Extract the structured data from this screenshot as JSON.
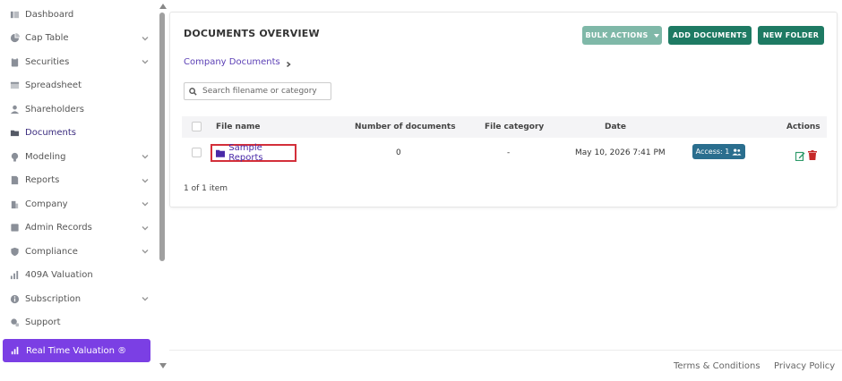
{
  "sidebar": {
    "items": [
      {
        "label": "Dashboard",
        "icon": "dashboard-icon",
        "chevron": false,
        "active": false
      },
      {
        "label": "Cap Table",
        "icon": "pie-chart-icon",
        "chevron": true,
        "active": false
      },
      {
        "label": "Securities",
        "icon": "clipboard-icon",
        "chevron": true,
        "active": false
      },
      {
        "label": "Spreadsheet",
        "icon": "spreadsheet-icon",
        "chevron": false,
        "active": false
      },
      {
        "label": "Shareholders",
        "icon": "user-icon",
        "chevron": false,
        "active": false
      },
      {
        "label": "Documents",
        "icon": "folder-icon",
        "chevron": false,
        "active": true
      },
      {
        "label": "Modeling",
        "icon": "lightbulb-icon",
        "chevron": true,
        "active": false
      },
      {
        "label": "Reports",
        "icon": "report-icon",
        "chevron": true,
        "active": false
      },
      {
        "label": "Company",
        "icon": "building-icon",
        "chevron": true,
        "active": false
      },
      {
        "label": "Admin Records",
        "icon": "records-icon",
        "chevron": true,
        "active": false
      },
      {
        "label": "Compliance",
        "icon": "shield-icon",
        "chevron": true,
        "active": false
      },
      {
        "label": "409A Valuation",
        "icon": "bar-chart-icon",
        "chevron": false,
        "active": false
      },
      {
        "label": "Subscription",
        "icon": "info-icon",
        "chevron": true,
        "active": false
      },
      {
        "label": "Support",
        "icon": "support-icon",
        "chevron": false,
        "active": false
      }
    ],
    "rtv_label": "Real Time Valuation ®"
  },
  "documents": {
    "title": "DOCUMENTS OVERVIEW",
    "bulk_actions": "BULK ACTIONS",
    "add_documents": "ADD DOCUMENTS",
    "new_folder": "NEW FOLDER",
    "breadcrumb": "Company Documents",
    "search_placeholder": "Search filename or category",
    "columns": {
      "file_name": "File name",
      "num_docs": "Number of documents",
      "category": "File category",
      "date": "Date",
      "actions": "Actions"
    },
    "rows": [
      {
        "name": "Sample Reports",
        "num_docs": "0",
        "category": "-",
        "date": "May 10, 2026 7:41 PM",
        "access": "Access: 1"
      }
    ],
    "item_count": "1 of 1 item"
  },
  "footer": {
    "terms": "Terms & Conditions",
    "privacy": "Privacy Policy"
  },
  "colors": {
    "accent_purple": "#7b3fe4",
    "primary_green": "#1e7a63",
    "bulk_green": "#7fb8a8",
    "access_blue": "#2a6e8e",
    "delete_red": "#c62828",
    "highlight_red": "#d32f3a"
  }
}
